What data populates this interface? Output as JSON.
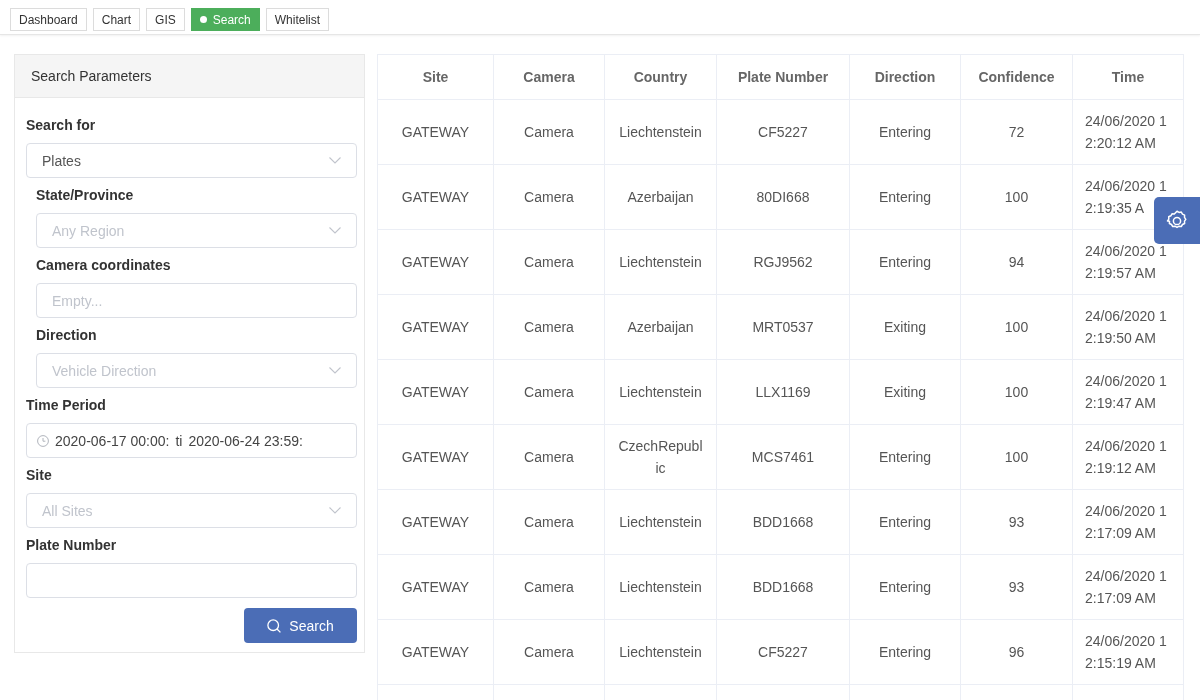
{
  "nav_tabs": [
    {
      "label": "Dashboard",
      "selected": false
    },
    {
      "label": "Chart",
      "selected": false
    },
    {
      "label": "GIS",
      "selected": false
    },
    {
      "label": "Search",
      "selected": true
    },
    {
      "label": "Whitelist",
      "selected": false
    }
  ],
  "search_panel": {
    "title": "Search Parameters",
    "fields": [
      {
        "kind": "select",
        "label": "Search for",
        "value": "Plates",
        "children": [
          {
            "kind": "select",
            "label": "State/Province",
            "placeholder": "Any Region"
          },
          {
            "kind": "input",
            "label": "Camera coordinates",
            "placeholder": "Empty..."
          },
          {
            "kind": "select",
            "label": "Direction",
            "placeholder": "Vehicle Direction"
          }
        ]
      },
      {
        "kind": "date_range",
        "label": "Time Period",
        "start": "2020-06-17 00:00:",
        "separator": "ti",
        "end": "2020-06-24 23:59:"
      },
      {
        "kind": "select",
        "label": "Site",
        "placeholder": "All Sites"
      },
      {
        "kind": "input",
        "label": "Plate Number"
      }
    ],
    "button": {
      "label": "Search"
    }
  },
  "results_table": {
    "columns": [
      "Site",
      "Camera",
      "Country",
      "Plate Number",
      "Direction",
      "Confidence",
      "Time"
    ],
    "rows": [
      [
        "GATEWAY",
        "Camera",
        "Liechtenstein",
        "CF5227",
        "Entering",
        "72",
        "24/06/2020 12:20:12 AM"
      ],
      [
        "GATEWAY",
        "Camera",
        "Azerbaijan",
        "80DI668",
        "Entering",
        "100",
        "24/06/2020 12:19:35 A"
      ],
      [
        "GATEWAY",
        "Camera",
        "Liechtenstein",
        "RGJ9562",
        "Entering",
        "94",
        "24/06/2020 12:19:57 AM"
      ],
      [
        "GATEWAY",
        "Camera",
        "Azerbaijan",
        "MRT0537",
        "Exiting",
        "100",
        "24/06/2020 12:19:50 AM"
      ],
      [
        "GATEWAY",
        "Camera",
        "Liechtenstein",
        "LLX1169",
        "Exiting",
        "100",
        "24/06/2020 12:19:47 AM"
      ],
      [
        "GATEWAY",
        "Camera",
        "CzechRepublic",
        "MCS7461",
        "Entering",
        "100",
        "24/06/2020 12:19:12 AM"
      ],
      [
        "GATEWAY",
        "Camera",
        "Liechtenstein",
        "BDD1668",
        "Entering",
        "93",
        "24/06/2020 12:17:09 AM"
      ],
      [
        "GATEWAY",
        "Camera",
        "Liechtenstein",
        "BDD1668",
        "Entering",
        "93",
        "24/06/2020 12:17:09 AM"
      ],
      [
        "GATEWAY",
        "Camera",
        "Liechtenstein",
        "CF5227",
        "Entering",
        "96",
        "24/06/2020 12:15:19 AM"
      ]
    ]
  }
}
